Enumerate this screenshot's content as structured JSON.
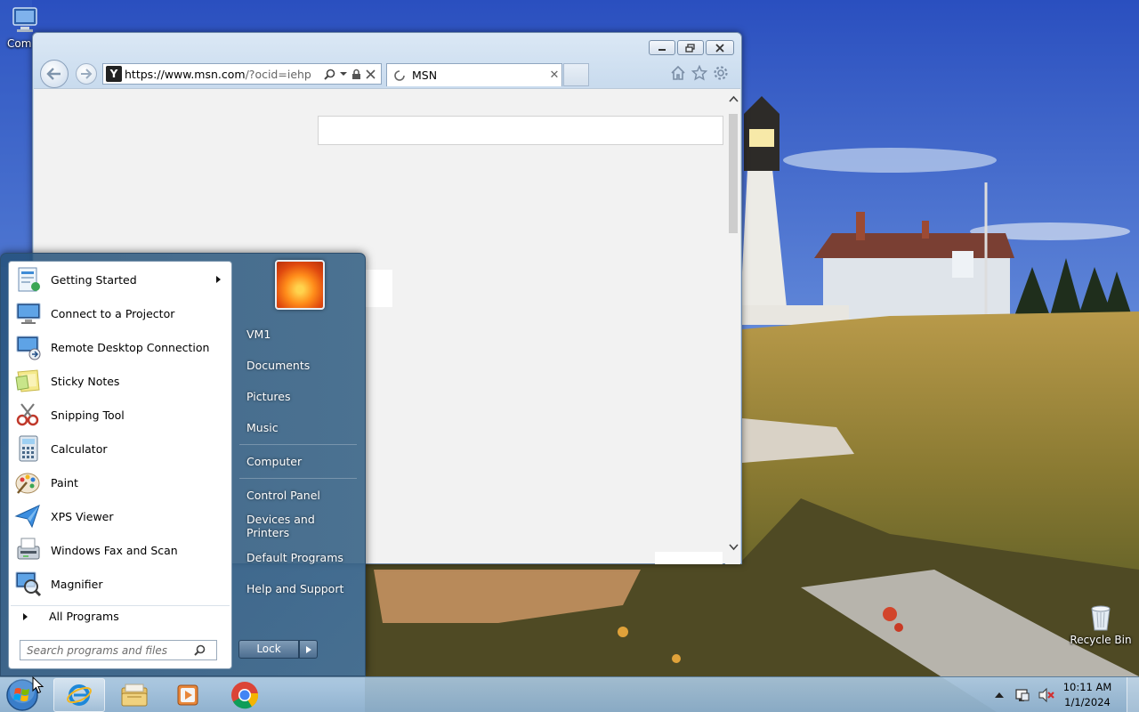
{
  "desktop": {
    "computer_label": "Com",
    "recycle_label": "Recycle Bin"
  },
  "ie": {
    "url_scheme": "https://",
    "url_domain": "www.msn.com",
    "url_path": "/?ocid=iehp",
    "tab_title": "MSN",
    "site_icon_text": "Y"
  },
  "start_menu": {
    "programs": [
      {
        "label": "Getting Started",
        "icon": "getting-started-icon",
        "has_submenu": true
      },
      {
        "label": "Connect to a Projector",
        "icon": "projector-icon"
      },
      {
        "label": "Remote Desktop Connection",
        "icon": "remote-desktop-icon"
      },
      {
        "label": "Sticky Notes",
        "icon": "sticky-notes-icon"
      },
      {
        "label": "Snipping Tool",
        "icon": "snipping-tool-icon"
      },
      {
        "label": "Calculator",
        "icon": "calculator-icon"
      },
      {
        "label": "Paint",
        "icon": "paint-icon"
      },
      {
        "label": "XPS Viewer",
        "icon": "xps-viewer-icon"
      },
      {
        "label": "Windows Fax and Scan",
        "icon": "fax-scan-icon"
      },
      {
        "label": "Magnifier",
        "icon": "magnifier-icon"
      }
    ],
    "all_programs": "All Programs",
    "search_placeholder": "Search programs and files",
    "right_items": [
      "VM1",
      "Documents",
      "Pictures",
      "Music",
      "Computer",
      "Control Panel",
      "Devices and Printers",
      "Default Programs",
      "Help and Support"
    ],
    "lock_label": "Lock"
  },
  "taskbar": {
    "time": "10:11 AM",
    "date": "1/1/2024"
  },
  "colors": {
    "accent": "#3a6ea5",
    "start_menu_bg": "#2f5b82"
  }
}
